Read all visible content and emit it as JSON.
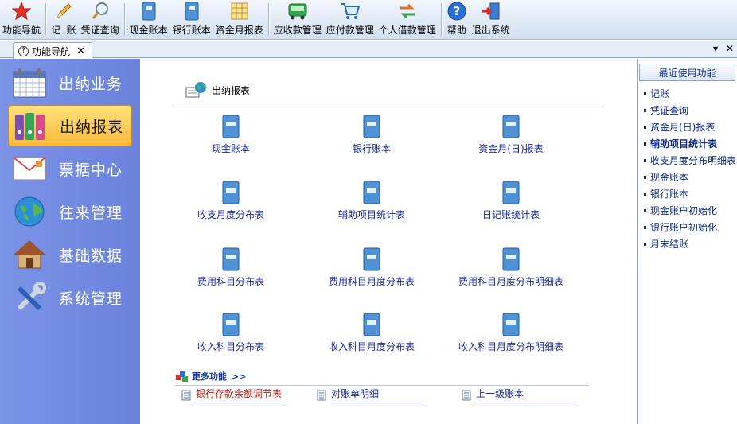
{
  "toolbar": {
    "items": [
      {
        "label": "功能导航",
        "icon": "star-icon"
      },
      {
        "label": "记  账",
        "icon": "pencil-icon"
      },
      {
        "label": "凭证查询",
        "icon": "magnifier-icon"
      },
      {
        "label": "现金账本",
        "icon": "ledger-icon"
      },
      {
        "label": "银行账本",
        "icon": "ledger-icon"
      },
      {
        "label": "资金月报表",
        "icon": "grid-report-icon"
      },
      {
        "label": "应收款管理",
        "icon": "bus-icon"
      },
      {
        "label": "应付款管理",
        "icon": "cart-icon"
      },
      {
        "label": "个人借款管理",
        "icon": "exchange-icon"
      },
      {
        "label": "帮助",
        "icon": "help-icon"
      },
      {
        "label": "退出系统",
        "icon": "exit-icon"
      }
    ]
  },
  "tabs": {
    "active_label": "功能导航",
    "close_glyph": "✕",
    "ctrl_down": "▾",
    "ctrl_close": "✕"
  },
  "leftnav": {
    "items": [
      {
        "label": "出纳业务",
        "icon": "calendar-icon",
        "active": false
      },
      {
        "label": "出纳报表",
        "icon": "binders-icon",
        "active": true
      },
      {
        "label": "票据中心",
        "icon": "envelope-icon",
        "active": false
      },
      {
        "label": "往来管理",
        "icon": "globe-icon",
        "active": false
      },
      {
        "label": "基础数据",
        "icon": "house-icon",
        "active": false
      },
      {
        "label": "系统管理",
        "icon": "tools-icon",
        "active": false
      }
    ]
  },
  "main": {
    "section_title": "出纳报表",
    "items": [
      [
        "现金账本",
        "银行账本",
        "资金月(日)报表"
      ],
      [
        "收支月度分布表",
        "辅助项目统计表",
        "日记账统计表"
      ],
      [
        "费用科目分布表",
        "费用科目月度分布表",
        "费用科目月度分布明细表"
      ],
      [
        "收入科目分布表",
        "收入科目月度分布表",
        "收入科目月度分布明细表"
      ]
    ],
    "more": {
      "title": "更多功能",
      "arrow": ">>",
      "links": [
        {
          "label": "银行存款余额调节表",
          "color": "#c0201a"
        },
        {
          "label": "对账单明细",
          "color": "#1a2aa8"
        },
        {
          "label": "上一级账本",
          "color": "#1a2aa8"
        }
      ]
    }
  },
  "recent": {
    "title": "最近使用功能",
    "items": [
      {
        "label": "记账",
        "bold": false
      },
      {
        "label": "凭证查询",
        "bold": false
      },
      {
        "label": "资金月(日)报表",
        "bold": false
      },
      {
        "label": "辅助项目统计表",
        "bold": true
      },
      {
        "label": "收支月度分布明细表",
        "bold": false
      },
      {
        "label": "现金账本",
        "bold": false
      },
      {
        "label": "银行账本",
        "bold": false
      },
      {
        "label": "现金账户初始化",
        "bold": false
      },
      {
        "label": "银行账户初始化",
        "bold": false
      },
      {
        "label": "月末结账",
        "bold": false
      }
    ]
  }
}
